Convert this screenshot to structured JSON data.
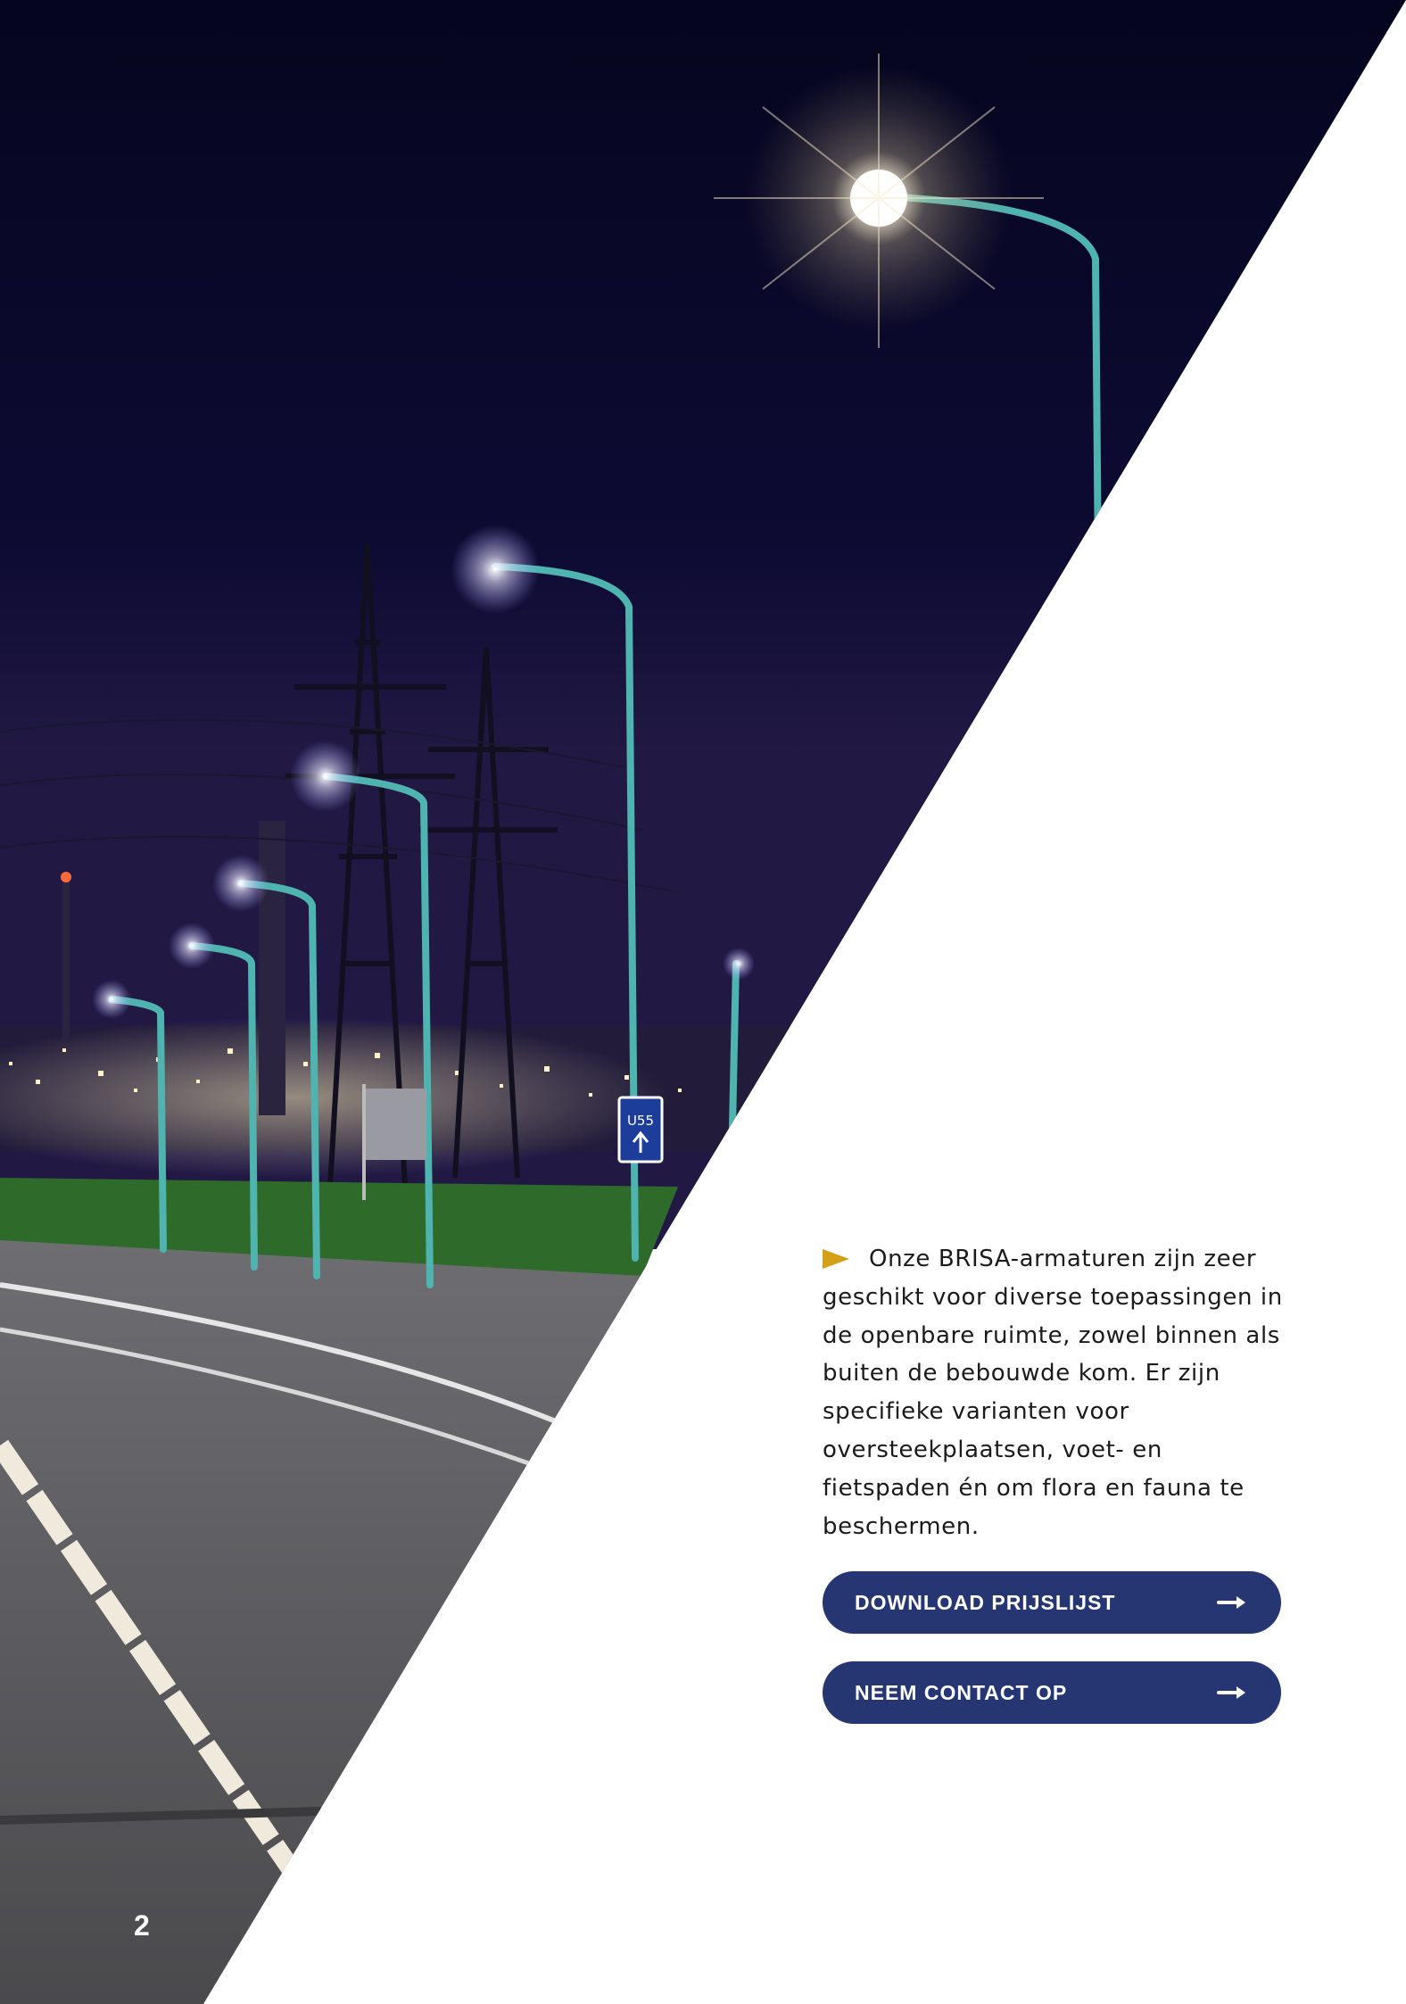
{
  "page": {
    "number": "2"
  },
  "content": {
    "paragraph": "Onze BRISA-armaturen zijn zeer geschikt voor diverse toepassingen in de openbare ruimte, zowel binnen als buiten de bebouwde kom. Er zijn specifieke varianten voor oversteekplaatsen, voet- en fietspaden én om flora en fauna te beschermen."
  },
  "photo": {
    "sign_text": "U55"
  },
  "buttons": {
    "download_label": "DOWNLOAD PRIJSLIJST",
    "contact_label": "NEEM CONTACT OP"
  },
  "colors": {
    "button_bg": "#253673",
    "bullet": "#d4a017",
    "night_sky": "#0a0a2c",
    "pole": "#4fb3b0"
  },
  "icons": {
    "bullet": "flag-triangle-icon",
    "button_arrow": "arrow-right-icon"
  }
}
